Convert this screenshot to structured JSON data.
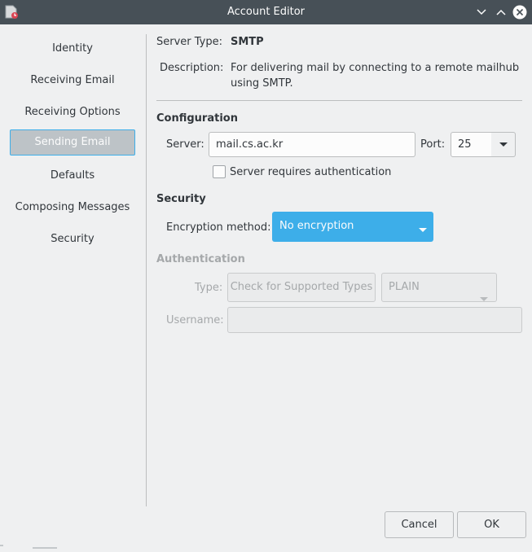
{
  "window": {
    "title": "Account Editor",
    "icons": [
      "app-icon",
      "minimize-icon",
      "maximize-icon",
      "close-icon"
    ]
  },
  "sidebar": {
    "items": [
      {
        "label": "Identity"
      },
      {
        "label": "Receiving Email"
      },
      {
        "label": "Receiving Options"
      },
      {
        "label": "Sending Email",
        "active": true
      },
      {
        "label": "Defaults"
      },
      {
        "label": "Composing Messages"
      },
      {
        "label": "Security"
      }
    ]
  },
  "server_info": {
    "type_label": "Server Type:",
    "type_value": "SMTP",
    "description_label": "Description:",
    "description_line1": "For delivering mail by connecting to a remote mailhub",
    "description_line2": "using SMTP."
  },
  "configuration": {
    "heading": "Configuration",
    "server_label": "Server:",
    "server_value": "mail.cs.ac.kr",
    "port_label": "Port:",
    "port_value": "25",
    "auth_checkbox_label": "Server requires authentication",
    "auth_checked": false
  },
  "security": {
    "heading": "Security",
    "encryption_label": "Encryption method:",
    "encryption_value": "No encryption",
    "accent": "#3daee9"
  },
  "authentication": {
    "heading": "Authentication",
    "type_label": "Type:",
    "check_button_label": "Check for Supported Types",
    "type_value": "PLAIN",
    "username_label": "Username:",
    "username_value": ""
  },
  "footer": {
    "cancel_label": "Cancel",
    "ok_label": "OK"
  }
}
